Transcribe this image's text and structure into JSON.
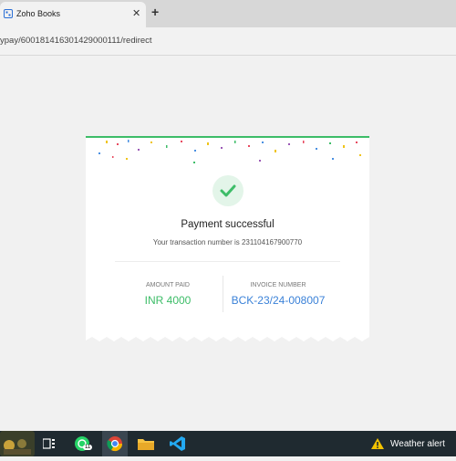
{
  "browser": {
    "tab_title": "Zoho Books",
    "tab_close": "✕",
    "new_tab": "+",
    "address": "ypay/600181416301429000111/redirect"
  },
  "payment": {
    "title": "Payment successful",
    "transaction_text": "Your transaction number is 231104167900770",
    "amount_label": "AMOUNT PAID",
    "amount_value": "INR 4000",
    "invoice_label": "INVOICE NUMBER",
    "invoice_value": "BCK-23/24-008007"
  },
  "taskbar": {
    "whatsapp_badge": "11",
    "weather_label": "Weather alert"
  },
  "colors": {
    "success": "#3dbd68",
    "link": "#3b82d8"
  }
}
